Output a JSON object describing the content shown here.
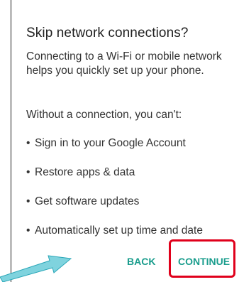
{
  "dialog": {
    "title": "Skip network connections?",
    "body": "Connecting to a Wi-Fi or mobile network helps you quickly set up your phone.",
    "lead": "Without a connection, you can't:",
    "bullet_char": "•",
    "bullets": [
      "Sign in to your Google Account",
      "Restore apps & data",
      "Get software updates",
      "Automatically set up time and date"
    ],
    "back_label": "BACK",
    "continue_label": "CONTINUE"
  },
  "colors": {
    "accent": "#1a9d8d",
    "highlight": "#e0001b",
    "arrow": "#7fd3de"
  }
}
